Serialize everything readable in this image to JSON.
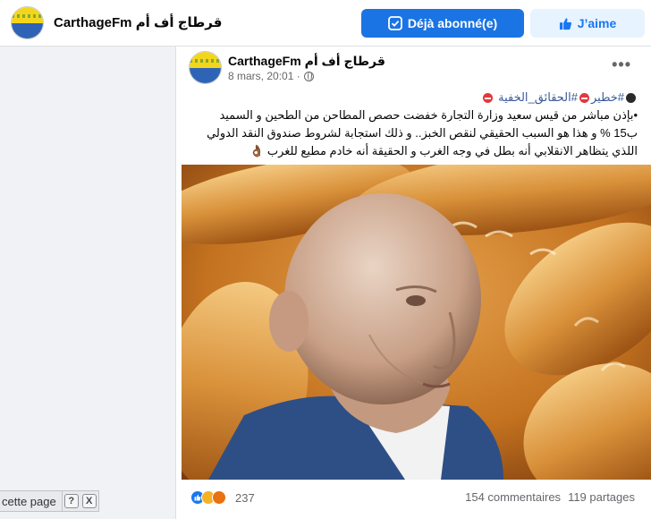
{
  "header": {
    "page_name": "CarthageFm قرطاج أف أم",
    "subscribed_label": "Déjà abonné(e)",
    "like_label": "J’aime"
  },
  "post": {
    "author": "CarthageFm قرطاج أف أم",
    "time": "8 mars, 20:01 ·",
    "hashtag_1": "#خطير",
    "hashtag_2": "#الحقائق_الخفية",
    "line_1": "•بإذن مباشر من قيس سعيد وزارة التجارة خفضت حصص المطاحن من الطحين و السميد",
    "line_2": "ب15 % و هذا هو السبب الحقيقي لنقص الخبز.. و ذلك استجابة لشروط صندوق النقد الدولي",
    "line_3": "اللذي يتظاهر الانقلابي أنه بطل في وجه الغرب و الحقيقة أنه خادم مطيع للغرب 👌🏾",
    "reaction_count": "237",
    "comments": "154 commentaires",
    "shares": "119 partages"
  },
  "translate_bar": {
    "label": "cette page",
    "help": "?",
    "close": "X"
  },
  "icons": {
    "subscribed": "check-badge-icon",
    "like": "thumbs-up-icon",
    "privacy": "globe-icon",
    "more": "more-options-icon"
  },
  "colors": {
    "primary_button": "#1b74e4",
    "secondary_button": "#e7f3ff",
    "hashtag": "#385898",
    "background": "#f0f2f5"
  }
}
